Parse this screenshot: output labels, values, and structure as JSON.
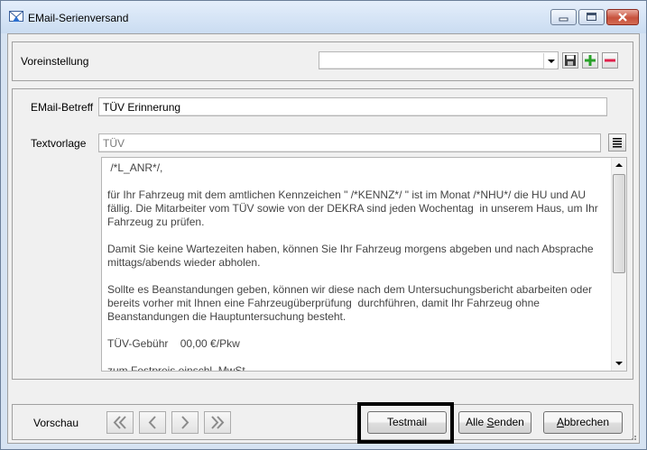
{
  "window": {
    "title": "EMail-Serienversand"
  },
  "preset": {
    "label": "Voreinstellung",
    "value": ""
  },
  "fields": {
    "subject_label": "EMail-Betreff",
    "subject_value": "TÜV Erinnerung",
    "template_label": "Textvorlage",
    "template_value": "TÜV"
  },
  "body_text": " /*L_ANR*/,\n\nfür Ihr Fahrzeug mit dem amtlichen Kennzeichen \" /*KENNZ*/ \" ist im Monat /*NHU*/ die HU und AU fällig. Die Mitarbeiter vom TÜV sowie von der DEKRA sind jeden Wochentag  in unserem Haus, um Ihr Fahrzeug zu prüfen.\n\nDamit Sie keine Wartezeiten haben, können Sie Ihr Fahrzeug morgens abgeben und nach Absprache mittags/abends wieder abholen.\n\nSollte es Beanstandungen geben, können wir diese nach dem Untersuchungsbericht abarbeiten oder bereits vorher mit Ihnen eine Fahrzeugüberprüfung  durchführen, damit Ihr Fahrzeug ohne Beanstandungen die Hauptuntersuchung besteht.\n\nTÜV-Gebühr    00,00 €/Pkw\n\nzum Festpreis einschl. MwSt.",
  "footer": {
    "preview_label": "Vorschau",
    "testmail_label": "Testmail",
    "send_all_prefix": "Alle ",
    "send_all_key": "S",
    "send_all_suffix": "enden",
    "cancel_key": "A",
    "cancel_suffix": "bbrechen"
  },
  "colors": {
    "add_green": "#2aa12a",
    "remove_red": "#e0204a",
    "close_red": "#c7513c"
  },
  "icons": [
    "app-mail-icon",
    "minimize-icon",
    "maximize-icon",
    "close-icon",
    "save-icon",
    "add-icon",
    "remove-icon",
    "list-icon",
    "first-icon",
    "prev-icon",
    "next-icon",
    "last-icon"
  ]
}
